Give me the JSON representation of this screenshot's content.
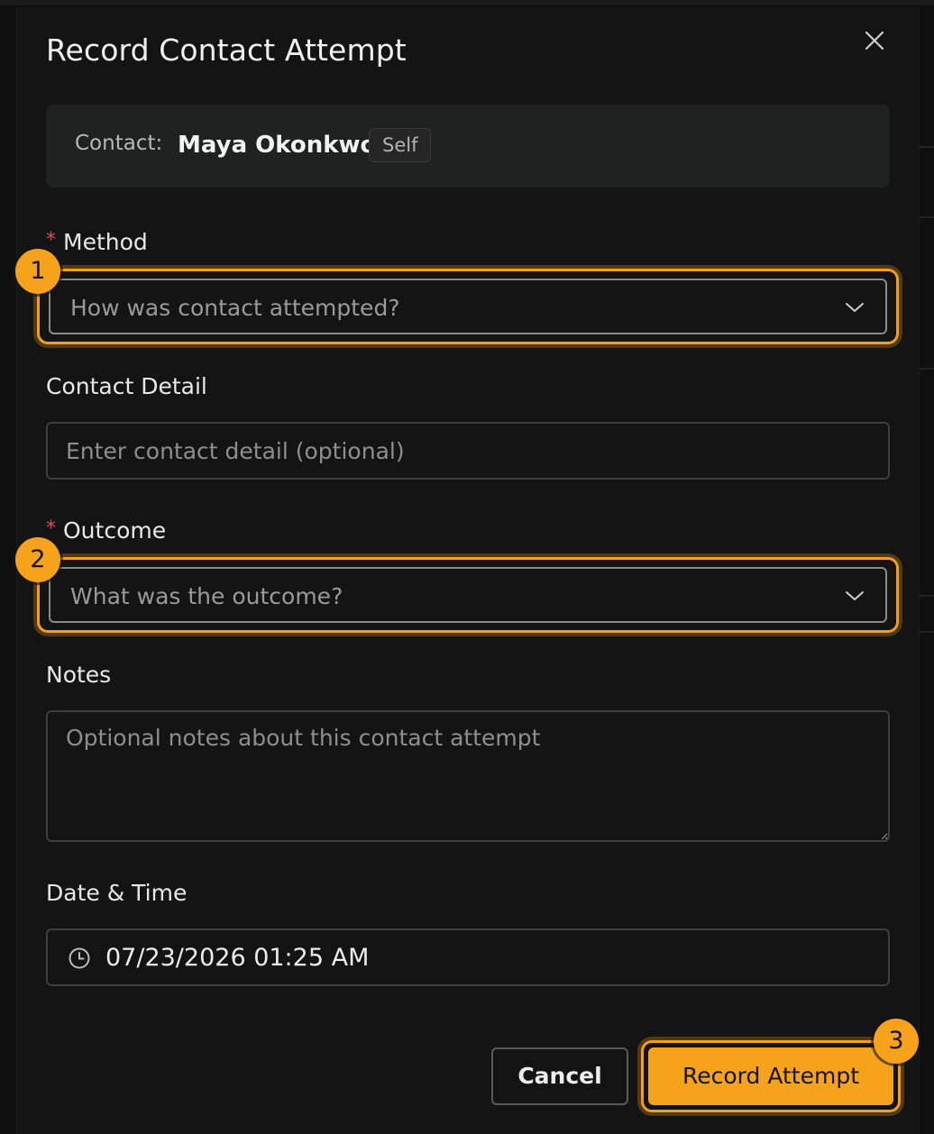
{
  "dialog": {
    "title": "Record Contact Attempt",
    "close_icon": "close-icon"
  },
  "contact": {
    "label": "Contact:",
    "name": "Maya Okonkwo",
    "relationship": "Self"
  },
  "method": {
    "label": "Method",
    "required_mark": "*",
    "placeholder": "How was contact attempted?",
    "step": "1"
  },
  "contact_detail": {
    "label": "Contact Detail",
    "placeholder": "Enter contact detail (optional)"
  },
  "outcome": {
    "label": "Outcome",
    "required_mark": "*",
    "placeholder": "What was the outcome?",
    "step": "2"
  },
  "notes": {
    "label": "Notes",
    "placeholder": "Optional notes about this contact attempt"
  },
  "datetime": {
    "label": "Date & Time",
    "value": "07/23/2026 01:25 AM"
  },
  "actions": {
    "cancel_label": "Cancel",
    "submit_label": "Record Attempt",
    "step": "3"
  },
  "colors": {
    "accent": "#f7a21b",
    "required": "#e5484d",
    "surface": "#141414",
    "panel": "#202121"
  }
}
